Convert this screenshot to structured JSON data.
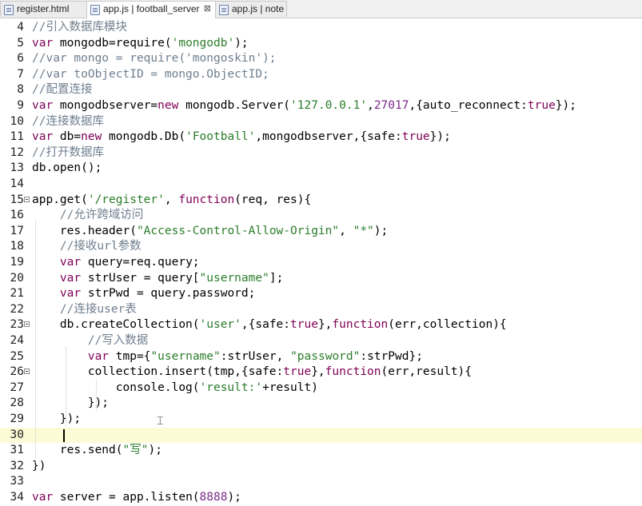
{
  "tabs": [
    {
      "label": "register.html",
      "icon": "file-icon",
      "active": false
    },
    {
      "label": "app.js | football_server",
      "icon": "file-icon",
      "active": true,
      "close": "⊠"
    },
    {
      "label": "app.js | note",
      "icon": "file-icon",
      "active": false
    }
  ],
  "editor": {
    "current_line": 30,
    "lines": [
      {
        "n": "4",
        "html": "<span class=\"cm\">//引入数据库模块</span>"
      },
      {
        "n": "5",
        "html": "<span class=\"kw\">var</span> mongodb=require(<span class=\"str\">'mongodb'</span>);"
      },
      {
        "n": "6",
        "html": "<span class=\"cm\">//var mongo = require('mongoskin');</span>"
      },
      {
        "n": "7",
        "html": "<span class=\"cm\">//var toObjectID = mongo.ObjectID;</span>"
      },
      {
        "n": "8",
        "html": "<span class=\"cm\">//配置连接</span>"
      },
      {
        "n": "9",
        "html": "<span class=\"kw\">var</span> mongodbserver=<span class=\"kw\">new</span> mongodb.Server(<span class=\"str\">'127.0.0.1'</span>,<span class=\"num\">27017</span>,{auto_reconnect:<span class=\"kw\">true</span>});"
      },
      {
        "n": "10",
        "html": "<span class=\"cm\">//连接数据库</span>"
      },
      {
        "n": "11",
        "html": "<span class=\"kw\">var</span> db=<span class=\"kw\">new</span> mongodb.Db(<span class=\"str\">'Football'</span>,mongodbserver,{safe:<span class=\"kw\">true</span>});"
      },
      {
        "n": "12",
        "html": "<span class=\"cm\">//打开数据库</span>"
      },
      {
        "n": "13",
        "html": "db.open();"
      },
      {
        "n": "14",
        "html": ""
      },
      {
        "n": "15",
        "fold": true,
        "html": "app.get(<span class=\"str\">'/register'</span>, <span class=\"kw\">function</span>(req, res){"
      },
      {
        "n": "16",
        "html": "    <span class=\"cm\">//允许跨域访问</span>"
      },
      {
        "n": "17",
        "html": "    res.header(<span class=\"str\">\"Access-Control-Allow-Origin\"</span>, <span class=\"str\">\"*\"</span>);"
      },
      {
        "n": "18",
        "html": "    <span class=\"cm\">//接收url参数</span>"
      },
      {
        "n": "19",
        "html": "    <span class=\"kw\">var</span> query=req.query;"
      },
      {
        "n": "20",
        "html": "    <span class=\"kw\">var</span> strUser = query[<span class=\"str\">\"username\"</span>];"
      },
      {
        "n": "21",
        "html": "    <span class=\"kw\">var</span> strPwd = query.password;"
      },
      {
        "n": "22",
        "html": "    <span class=\"cm\">//连接user表</span>"
      },
      {
        "n": "23",
        "fold": true,
        "html": "    db.createCollection(<span class=\"str\">'user'</span>,{safe:<span class=\"kw\">true</span>},<span class=\"kw\">function</span>(err,collection){"
      },
      {
        "n": "24",
        "html": "        <span class=\"cm\">//写入数据</span>"
      },
      {
        "n": "25",
        "html": "        <span class=\"kw\">var</span> tmp={<span class=\"str\">\"username\"</span>:strUser, <span class=\"str\">\"password\"</span>:strPwd};"
      },
      {
        "n": "26",
        "fold": true,
        "html": "        collection.insert(tmp,{safe:<span class=\"kw\">true</span>},<span class=\"kw\">function</span>(err,result){"
      },
      {
        "n": "27",
        "html": "            console.log(<span class=\"str\">'result:'</span>+result)"
      },
      {
        "n": "28",
        "html": "        });"
      },
      {
        "n": "29",
        "html": "    });"
      },
      {
        "n": "30",
        "html": ""
      },
      {
        "n": "31",
        "html": "    res.send(<span class=\"str\">\"写\"</span>);"
      },
      {
        "n": "32",
        "html": "})"
      },
      {
        "n": "33",
        "html": ""
      },
      {
        "n": "34",
        "html": "<span class=\"kw\">var</span> server = app.listen(<span class=\"num\">8888</span>);"
      }
    ]
  }
}
